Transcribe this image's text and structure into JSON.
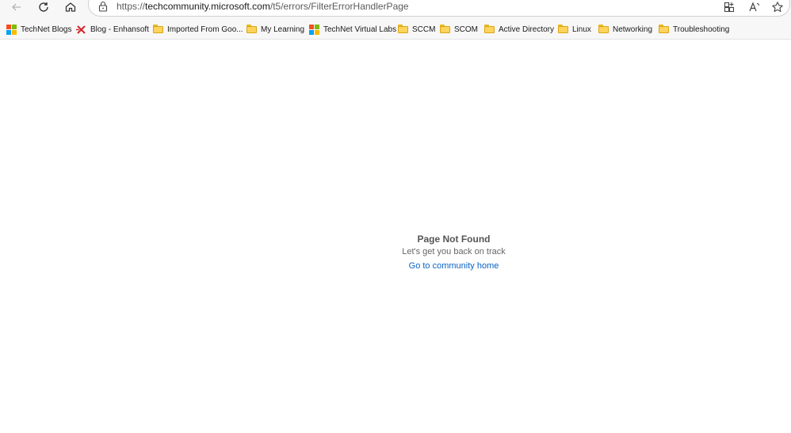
{
  "browser": {
    "url_prefix": "https://",
    "url_domain": "techcommunity.microsoft.com",
    "url_path": "/t5/errors/FilterErrorHandlerPage"
  },
  "favorites": [
    {
      "label": "TechNet Blogs",
      "icon": "microsoft-logo-icon"
    },
    {
      "label": "Blog - Enhansoft",
      "icon": "enhansoft-icon"
    },
    {
      "label": "Imported From Goo...",
      "icon": "folder-icon"
    },
    {
      "label": "My Learning",
      "icon": "folder-icon"
    },
    {
      "label": "TechNet Virtual Labs",
      "icon": "microsoft-logo-icon"
    },
    {
      "label": "SCCM",
      "icon": "folder-icon"
    },
    {
      "label": "SCOM",
      "icon": "folder-icon"
    },
    {
      "label": "Active Directory",
      "icon": "folder-icon"
    },
    {
      "label": "Linux",
      "icon": "folder-icon"
    },
    {
      "label": "Networking",
      "icon": "folder-icon"
    },
    {
      "label": "Troubleshooting",
      "icon": "folder-icon"
    }
  ],
  "error": {
    "title": "Page Not Found",
    "subtitle": "Let's get you back on track",
    "link": "Go to community home"
  },
  "colors": {
    "link": "#0b62c3",
    "folder": "#ffd35c",
    "ms_red": "#f25022",
    "ms_green": "#7fba00",
    "ms_blue": "#00a4ef",
    "ms_yellow": "#ffb900"
  }
}
